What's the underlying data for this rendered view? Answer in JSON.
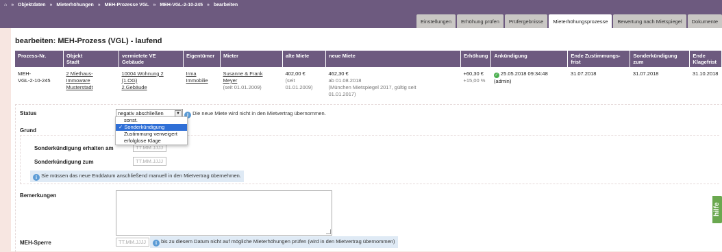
{
  "breadcrumb": {
    "home_icon": "home-icon",
    "items": [
      "Objektdaten",
      "Mieterhöhungen",
      "MEH-Prozesse VGL",
      "MEH-VGL-2-10-245",
      "bearbeiten"
    ],
    "separator": "»"
  },
  "tabs": [
    {
      "label": "Einstellungen",
      "active": false
    },
    {
      "label": "Erhöhung prüfen",
      "active": false
    },
    {
      "label": "Prüfergebnisse",
      "active": false
    },
    {
      "label": "Mieterhöhungsprozesse",
      "active": true
    },
    {
      "label": "Bewertung nach Mietspiegel",
      "active": false
    },
    {
      "label": "Dokumente",
      "active": false
    }
  ],
  "page_title": "bearbeiten: MEH-Prozess (VGL) - laufend",
  "table": {
    "headers": {
      "nr": "Prozess-Nr.",
      "objekt1": "Objekt",
      "objekt2": "Stadt",
      "ve1": "vermietete VE",
      "ve2": "Gebäude",
      "eigentuemer": "Eigentümer",
      "mieter": "Mieter",
      "alte": "alte Miete",
      "neue": "neue Miete",
      "erhoehung": "Erhöhung",
      "ankuendigung": "Ankündigung",
      "ende1": "Ende Zustimmungs-",
      "ende2": "frist",
      "sonder1": "Sonderkündigung",
      "sonder2": "zum",
      "klage1": "Ende",
      "klage2": "Klagefrist"
    },
    "row": {
      "nr1": "MEH-",
      "nr2": "VGL-2-10-245",
      "objekt1": "2 Miethaus-",
      "objekt2": "Immoware",
      "objekt3": "Musterstadt",
      "ve1": "10004 Wohnung 2",
      "ve2": "(1.OG)",
      "ve3": "2.Gebäude",
      "eig1": "Irma",
      "eig2": "Immobilie",
      "mieter1": "Susanne & Frank",
      "mieter2": "Meyer",
      "mieter3": "(seit 01.01.2009)",
      "alte1": "402,00 €",
      "alte2": "(seit",
      "alte3": "01.01.2009)",
      "neue1": "462,30 €",
      "neue2": "ab 01.08.2018",
      "neue3": "(München Mietspiegel 2017, gültig seit",
      "neue4": "01.01.2017)",
      "erh1": "+60,30 €",
      "erh2": "+15,00 %",
      "ank1": "25.05.2018 09:34:48",
      "ank2": "(admin)",
      "ende": "31.07.2018",
      "sonder": "31.07.2018",
      "klage": "31.10.2018"
    }
  },
  "form": {
    "status_label": "Status",
    "status_value": "negativ abschließen",
    "status_note": "Die neue Miete wird nicht in den Mietvertrag übernommen.",
    "grund_label": "Grund",
    "grund_options": [
      "sonst.",
      "Sonderkündigung",
      "Zustimmung verweigert",
      "erfolglose Klage"
    ],
    "grund_selected": "Sonderkündigung",
    "sk_erhalten_label": "Sonderkündigung erhalten am",
    "sk_zum_label": "Sonderkündigung zum",
    "date_placeholder": "TT.MM.JJJJ",
    "enddatum_note": "Sie müssen das neue Enddatum anschließend manuell in den Mietvertrag übernehmen.",
    "bemerkungen_label": "Bemerkungen",
    "meh_sperre_label": "MEH-Sperre",
    "meh_sperre_note": "bis zu diesem Datum nicht auf mögliche Mieterhöhungen prüfen (wird in den Mietvertrag übernommen)"
  },
  "help_label": "hilfe",
  "colors": {
    "header": "#6d5a7f",
    "background": "#f7e6e1",
    "note": "#dfeaf5",
    "help": "#6aa84f",
    "selected_option": "#2f6fd6"
  }
}
